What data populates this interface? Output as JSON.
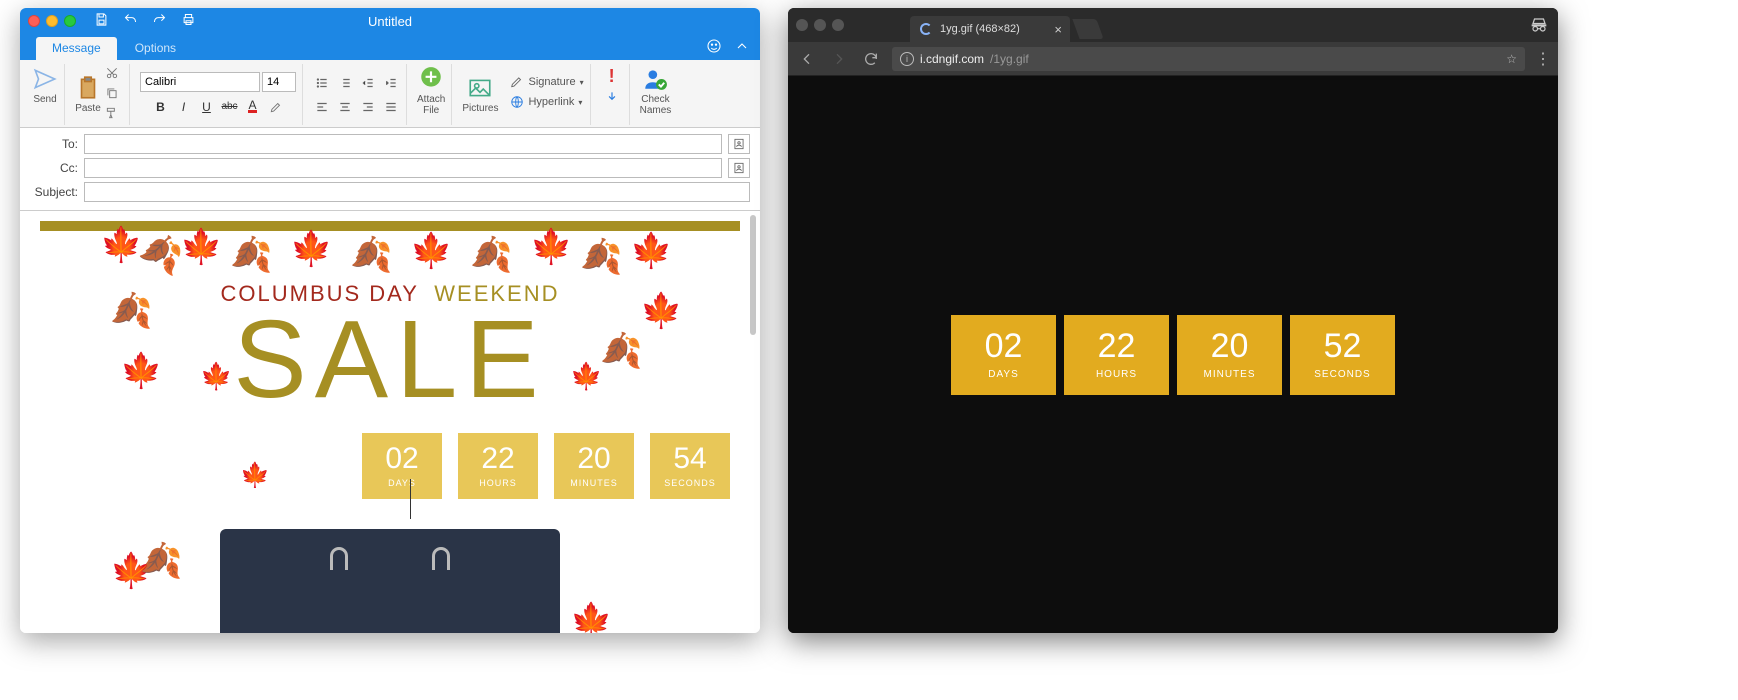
{
  "outlook": {
    "title": "Untitled",
    "tabs": {
      "message": "Message",
      "options": "Options"
    },
    "font": {
      "name": "Calibri",
      "size": "14"
    },
    "ribbon": {
      "send": "Send",
      "paste": "Paste",
      "attach": "Attach File",
      "pictures": "Pictures",
      "signature": "Signature",
      "hyperlink": "Hyperlink",
      "check_names": "Check Names"
    },
    "fields": {
      "to": "To:",
      "cc": "Cc:",
      "subject": "Subject:"
    },
    "email": {
      "headline1": "COLUMBUS DAY",
      "headline2": "WEEKEND",
      "sale": "SALE",
      "countdown": [
        {
          "num": "02",
          "lab": "DAYS"
        },
        {
          "num": "22",
          "lab": "HOURS"
        },
        {
          "num": "20",
          "lab": "MINUTES"
        },
        {
          "num": "54",
          "lab": "SECONDS"
        }
      ]
    }
  },
  "chrome": {
    "tab_title": "1yg.gif (468×82)",
    "url_host": "i.cdngif.com",
    "url_path": "/1yg.gif",
    "countdown": [
      {
        "num": "02",
        "lab": "DAYS"
      },
      {
        "num": "22",
        "lab": "HOURS"
      },
      {
        "num": "20",
        "lab": "MINUTES"
      },
      {
        "num": "52",
        "lab": "SECONDS"
      }
    ]
  }
}
